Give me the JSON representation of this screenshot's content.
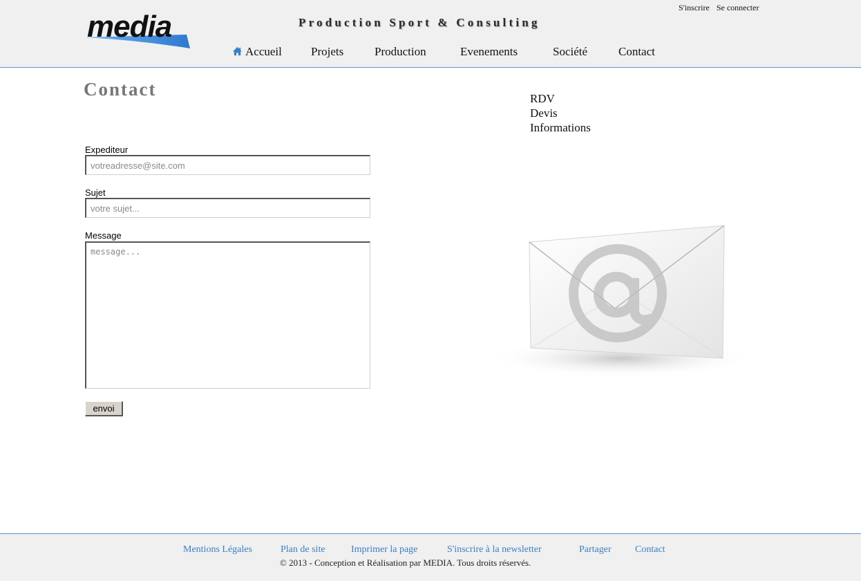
{
  "header": {
    "logo_text": "media",
    "tagline": "Production Sport & Consulting",
    "signup_link": "S'inscrire",
    "login_link": "Se connecter"
  },
  "nav": {
    "items": [
      {
        "label": "Accueil",
        "icon": "home-icon"
      },
      {
        "label": "Projets"
      },
      {
        "label": "Production"
      },
      {
        "label": "Evenements"
      },
      {
        "label": "Société"
      },
      {
        "label": "Contact"
      }
    ]
  },
  "main": {
    "title": "Contact",
    "form": {
      "sender_label": "Expediteur",
      "sender_placeholder": "votreadresse@site.com",
      "subject_label": "Sujet",
      "subject_placeholder": "votre sujet...",
      "message_label": "Message",
      "message_placeholder": "message...",
      "submit_label": "envoi"
    },
    "reasons": [
      "RDV",
      "Devis",
      "Informations"
    ],
    "illustration": "envelope-at-icon"
  },
  "footer": {
    "links": [
      "Mentions Légales",
      "Plan de site",
      "Imprimer la page",
      "S'inscrire à la newsletter",
      "Partager",
      "Contact"
    ],
    "copyright": "© 2013 - Conception et Réalisation par MEDIA. Tous droits réservés."
  },
  "colors": {
    "header_bg": "#f0f0f0",
    "accent_blue": "#3a7fc1",
    "logo_blue": "#4a8fd8",
    "title_gray": "#777777"
  }
}
